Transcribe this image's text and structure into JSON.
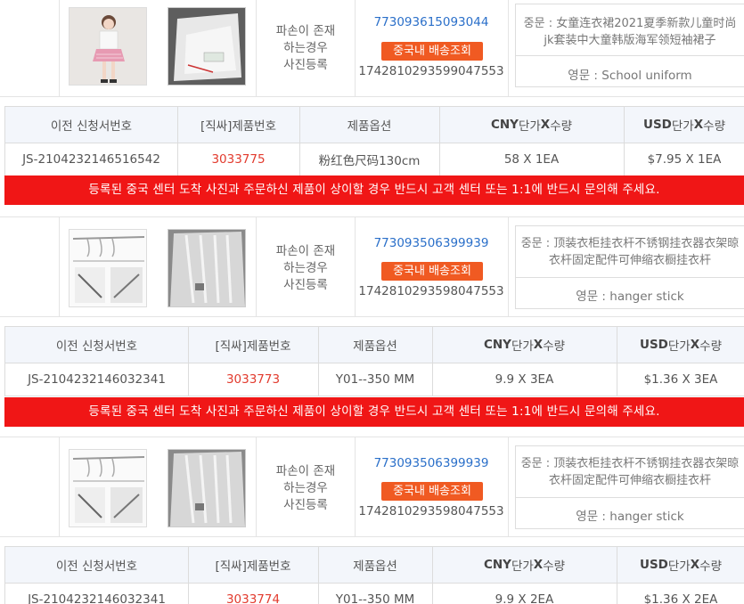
{
  "orders": [
    {
      "damage_text": [
        "파손이 존재",
        "하는경우",
        "사진등록"
      ],
      "tracking_link": "773093615093044",
      "tracking_button": "중국내 배송조회",
      "tracking_number": "1742810293599047553",
      "desc_cn": "중문 : 女童连衣裙2021夏季新款儿童时尚jk套装中大童韩版海军领短袖裙子",
      "desc_en": "영문 : School uniform",
      "product_image": "school-uniform-photo",
      "arrival_photo": "package-photo"
    },
    {
      "damage_text": [
        "파손이 존재",
        "하는경우",
        "사진등록"
      ],
      "tracking_link": "773093506399939",
      "tracking_button": "중국내 배송조회",
      "tracking_number": "1742810293598047553",
      "desc_cn": "중문 : 顶装衣柜挂衣杆不锈钢挂衣器衣架晾衣杆固定配件可伸缩衣橱挂衣杆",
      "desc_en": "영문 : hanger stick",
      "product_image": "hanger-stick-photo",
      "arrival_photo": "hanger-arrival-photo"
    },
    {
      "damage_text": [
        "파손이 존재",
        "하는경우",
        "사진등록"
      ],
      "tracking_link": "773093506399939",
      "tracking_button": "중국내 배송조회",
      "tracking_number": "1742810293598047553",
      "desc_cn": "중문 : 顶装衣柜挂衣杆不锈钢挂衣器衣架晾衣杆固定配件可伸缩衣橱挂衣杆",
      "desc_en": "영문 : hanger stick",
      "product_image": "hanger-stick-photo",
      "arrival_photo": "hanger-arrival-photo"
    }
  ],
  "table_headers": {
    "application_no": "이전 신청서번호",
    "product_no": "[직싸]제품번호",
    "option": "제품옵션",
    "cny_bold": "CNY",
    "cny_rest": " 단가",
    "cny_x": "X",
    "cny_qty": "수량",
    "usd_bold": "USD",
    "usd_rest": " 단가",
    "usd_x": "X",
    "usd_qty": "수량"
  },
  "rows": [
    {
      "application_no": "JS-2104232146516542",
      "product_no": "3033775",
      "option": "粉红色尺码130cm",
      "cny": "58 X 1EA",
      "usd": "$7.95 X 1EA"
    },
    {
      "application_no": "JS-2104232146032341",
      "product_no": "3033773",
      "option": "Y01--350 MM",
      "cny": "9.9 X 3EA",
      "usd": "$1.36 X 3EA"
    },
    {
      "application_no": "JS-2104232146032341",
      "product_no": "3033774",
      "option": "Y01--350 MM",
      "cny": "9.9 X 2EA",
      "usd": "$1.36 X 2EA"
    }
  ],
  "notice": "등록된 중국 센터 도착 사진과 주문하신 제품이 상이할 경우 반드시 고객 센터 또는 1:1에 반드시 문의해 주세요.",
  "colors": {
    "notice_bg": "#f01616",
    "track_button": "#f05a22",
    "link": "#2a6fc9",
    "product_no": "#e23b2e"
  }
}
